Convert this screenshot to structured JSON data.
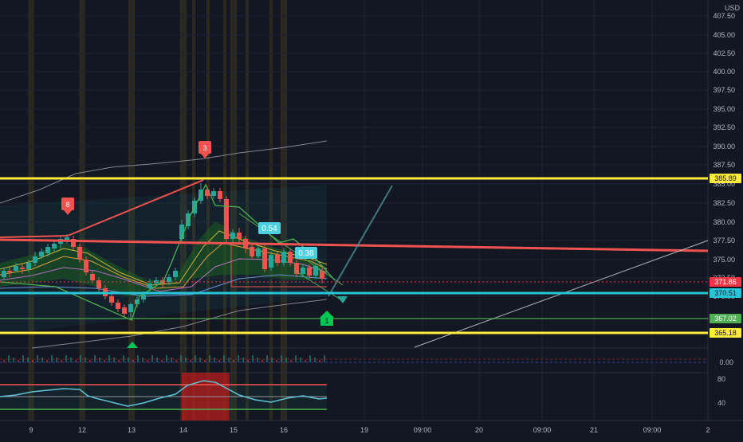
{
  "currency": "USD",
  "axis": {
    "price_ticks": [
      "407.50",
      "405.00",
      "402.50",
      "400.00",
      "397.50",
      "395.00",
      "392.50",
      "390.00",
      "387.50",
      "385.00",
      "382.50",
      "380.00",
      "377.50",
      "375.00",
      "372.50",
      "370.00"
    ],
    "time_ticks": [
      "9",
      "12",
      "13",
      "14",
      "15",
      "16",
      "19",
      "09:00",
      "20",
      "09:00",
      "21",
      "09:00",
      "2"
    ]
  },
  "price_tags": [
    {
      "label": "385.89",
      "bg": "#ffeb3b",
      "fg": "#131722"
    },
    {
      "label": "371.86",
      "bg": "#f23645",
      "fg": "#ffffff"
    },
    {
      "label": "370.51",
      "bg": "#26c6da",
      "fg": "#131722"
    },
    {
      "label": "367.02",
      "bg": "#4caf50",
      "fg": "#ffffff"
    },
    {
      "label": "365.18",
      "bg": "#ffeb3b",
      "fg": "#131722"
    }
  ],
  "markers": [
    {
      "label": "8",
      "kind": "sell"
    },
    {
      "label": "3",
      "kind": "sell"
    },
    {
      "label": "1",
      "kind": "buy"
    }
  ],
  "labels": [
    "0.54",
    "0.38"
  ],
  "pane1_tick": "0.00",
  "pane2_ticks": [
    "80",
    "40"
  ],
  "colors": {
    "background": "#131722",
    "bull": "#26a69a",
    "bear": "#ef5350",
    "support": "#ffeb3b",
    "cyan": "#26c6da",
    "trend": "#ef5350"
  }
}
